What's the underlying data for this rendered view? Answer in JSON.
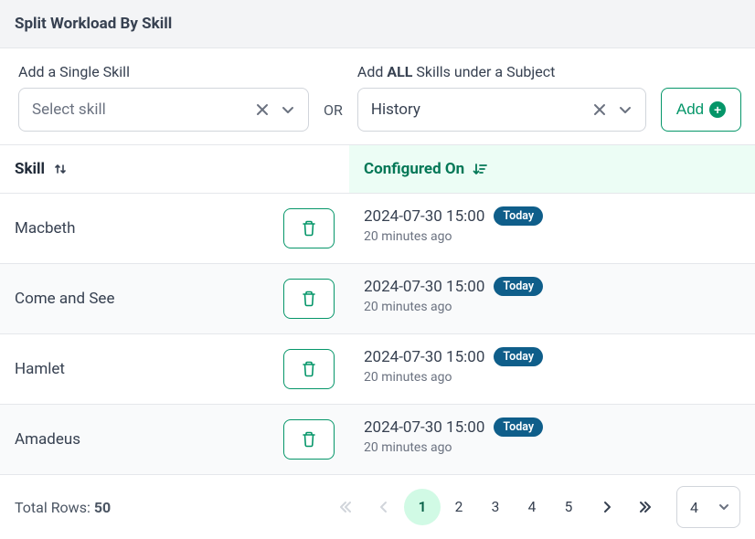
{
  "header": {
    "title": "Split Workload By Skill"
  },
  "filters": {
    "skill": {
      "label": "Add a Single Skill",
      "placeholder": "Select skill",
      "value": ""
    },
    "or": "OR",
    "subject": {
      "label_prefix": "Add ",
      "label_bold": "ALL",
      "label_suffix": " Skills under a Subject",
      "value": "History"
    },
    "add_label": "Add"
  },
  "columns": {
    "skill": "Skill",
    "configured": "Configured On"
  },
  "rows": [
    {
      "skill": "Macbeth",
      "timestamp": "2024-07-30 15:00",
      "badge": "Today",
      "ago": "20 minutes ago"
    },
    {
      "skill": "Come and See",
      "timestamp": "2024-07-30 15:00",
      "badge": "Today",
      "ago": "20 minutes ago"
    },
    {
      "skill": "Hamlet",
      "timestamp": "2024-07-30 15:00",
      "badge": "Today",
      "ago": "20 minutes ago"
    },
    {
      "skill": "Amadeus",
      "timestamp": "2024-07-30 15:00",
      "badge": "Today",
      "ago": "20 minutes ago"
    }
  ],
  "footer": {
    "total_label": "Total Rows: ",
    "total": "50",
    "pages": [
      "1",
      "2",
      "3",
      "4",
      "5"
    ],
    "active_page": "1",
    "page_size": "4"
  }
}
